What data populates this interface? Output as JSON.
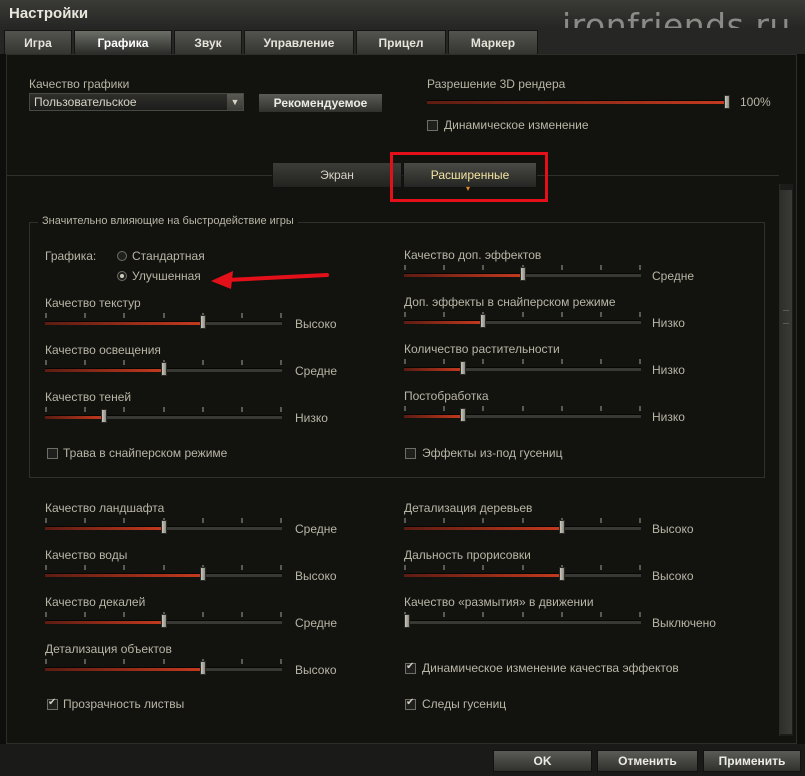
{
  "window": {
    "title": "Настройки"
  },
  "watermark": "ironfriends.ru",
  "tabs": [
    {
      "label": "Игра",
      "active": false
    },
    {
      "label": "Графика",
      "active": true
    },
    {
      "label": "Звук",
      "active": false
    },
    {
      "label": "Управление",
      "active": false
    },
    {
      "label": "Прицел",
      "active": false
    },
    {
      "label": "Маркер",
      "active": false
    }
  ],
  "quality": {
    "label": "Качество графики",
    "value": "Пользовательское",
    "recommended_button": "Рекомендуемое"
  },
  "resolution": {
    "label": "Разрешение 3D рендера",
    "value": "100%",
    "level": 1.0,
    "dynamic_label": "Динамическое изменение",
    "dynamic_checked": false
  },
  "subtabs": [
    {
      "label": "Экран",
      "active": false
    },
    {
      "label": "Расширенные",
      "active": true
    }
  ],
  "group": {
    "title": "Значительно влияющие на быстродействие игры"
  },
  "graphics_mode": {
    "label": "Графика:",
    "options": [
      {
        "label": "Стандартная",
        "checked": false
      },
      {
        "label": "Улучшенная",
        "checked": true
      }
    ]
  },
  "left_sliders_top": [
    {
      "label": "Качество текстур",
      "value": "Высоко",
      "level": 0.667
    },
    {
      "label": "Качество освещения",
      "value": "Средне",
      "level": 0.5
    },
    {
      "label": "Качество теней",
      "value": "Низко",
      "level": 0.25
    }
  ],
  "right_sliders_top": [
    {
      "label": "Качество доп. эффектов",
      "value": "Средне",
      "level": 0.5
    },
    {
      "label": "Доп. эффекты в снайперском режиме",
      "value": "Низко",
      "level": 0.333
    },
    {
      "label": "Количество растительности",
      "value": "Низко",
      "level": 0.25
    },
    {
      "label": "Постобработка",
      "value": "Низко",
      "level": 0.25
    }
  ],
  "checkbox_grass": {
    "label": "Трава в снайперском режиме",
    "checked": false
  },
  "checkbox_tracks_effects": {
    "label": "Эффекты из-под гусениц",
    "checked": false
  },
  "left_sliders_bottom": [
    {
      "label": "Качество ландшафта",
      "value": "Средне",
      "level": 0.5
    },
    {
      "label": "Качество воды",
      "value": "Высоко",
      "level": 0.667
    },
    {
      "label": "Качество декалей",
      "value": "Средне",
      "level": 0.5
    },
    {
      "label": "Детализация объектов",
      "value": "Высоко",
      "level": 0.667
    }
  ],
  "right_sliders_bottom": [
    {
      "label": "Детализация деревьев",
      "value": "Высоко",
      "level": 0.667
    },
    {
      "label": "Дальность прорисовки",
      "value": "Высоко",
      "level": 0.667
    },
    {
      "label": "Качество «размытия» в движении",
      "value": "Выключено",
      "level": 0.0
    }
  ],
  "checkbox_dynamic_effects": {
    "label": "Динамическое изменение качества эффектов",
    "checked": true
  },
  "checkbox_foliage": {
    "label": "Прозрачность листвы",
    "checked": true
  },
  "checkbox_track_marks": {
    "label": "Следы гусениц",
    "checked": true
  },
  "buttons": {
    "ok": "OK",
    "cancel": "Отменить",
    "apply": "Применить"
  },
  "colors": {
    "accent_red": "#c43a1f",
    "highlight_box": "#e3101a",
    "arrow": "#e3101a",
    "active_subtab_text": "#f4e3a0"
  }
}
